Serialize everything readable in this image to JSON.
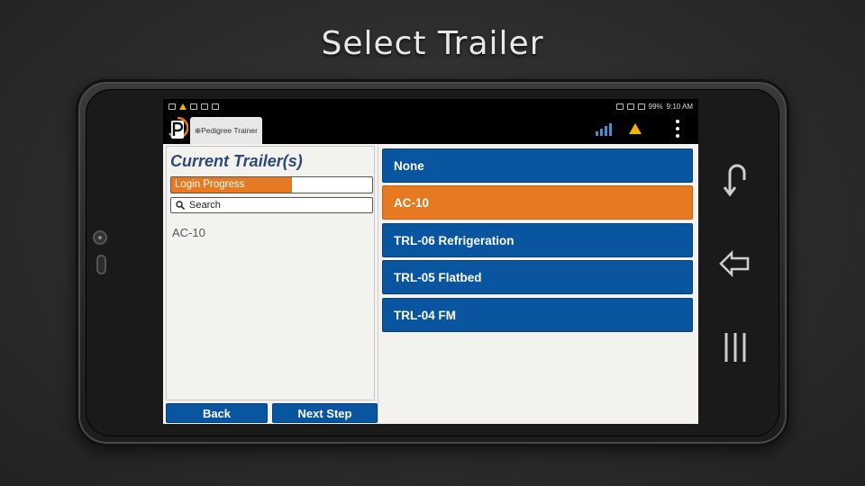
{
  "slide": {
    "title": "Select Trailer"
  },
  "statusbar": {
    "battery": "99%",
    "time": "9:10 AM"
  },
  "appbar": {
    "tab_label": "⊕Pedigree Trainer"
  },
  "left_panel": {
    "heading": "Current Trailer(s)",
    "progress_label": "Login Progress",
    "progress_value": 0.6,
    "search_placeholder": "Search",
    "current_items": [
      "AC-10"
    ]
  },
  "buttons": {
    "back": "Back",
    "next": "Next Step"
  },
  "trailers": [
    {
      "label": "None",
      "selected": false
    },
    {
      "label": "AC-10",
      "selected": true
    },
    {
      "label": "TRL-06 Refrigeration",
      "selected": false
    },
    {
      "label": "TRL-05 Flatbed",
      "selected": false
    },
    {
      "label": "TRL-04 FM",
      "selected": false
    }
  ],
  "colors": {
    "primary": "#0a55a0",
    "selected": "#e57a22",
    "heading": "#2b4a78"
  }
}
